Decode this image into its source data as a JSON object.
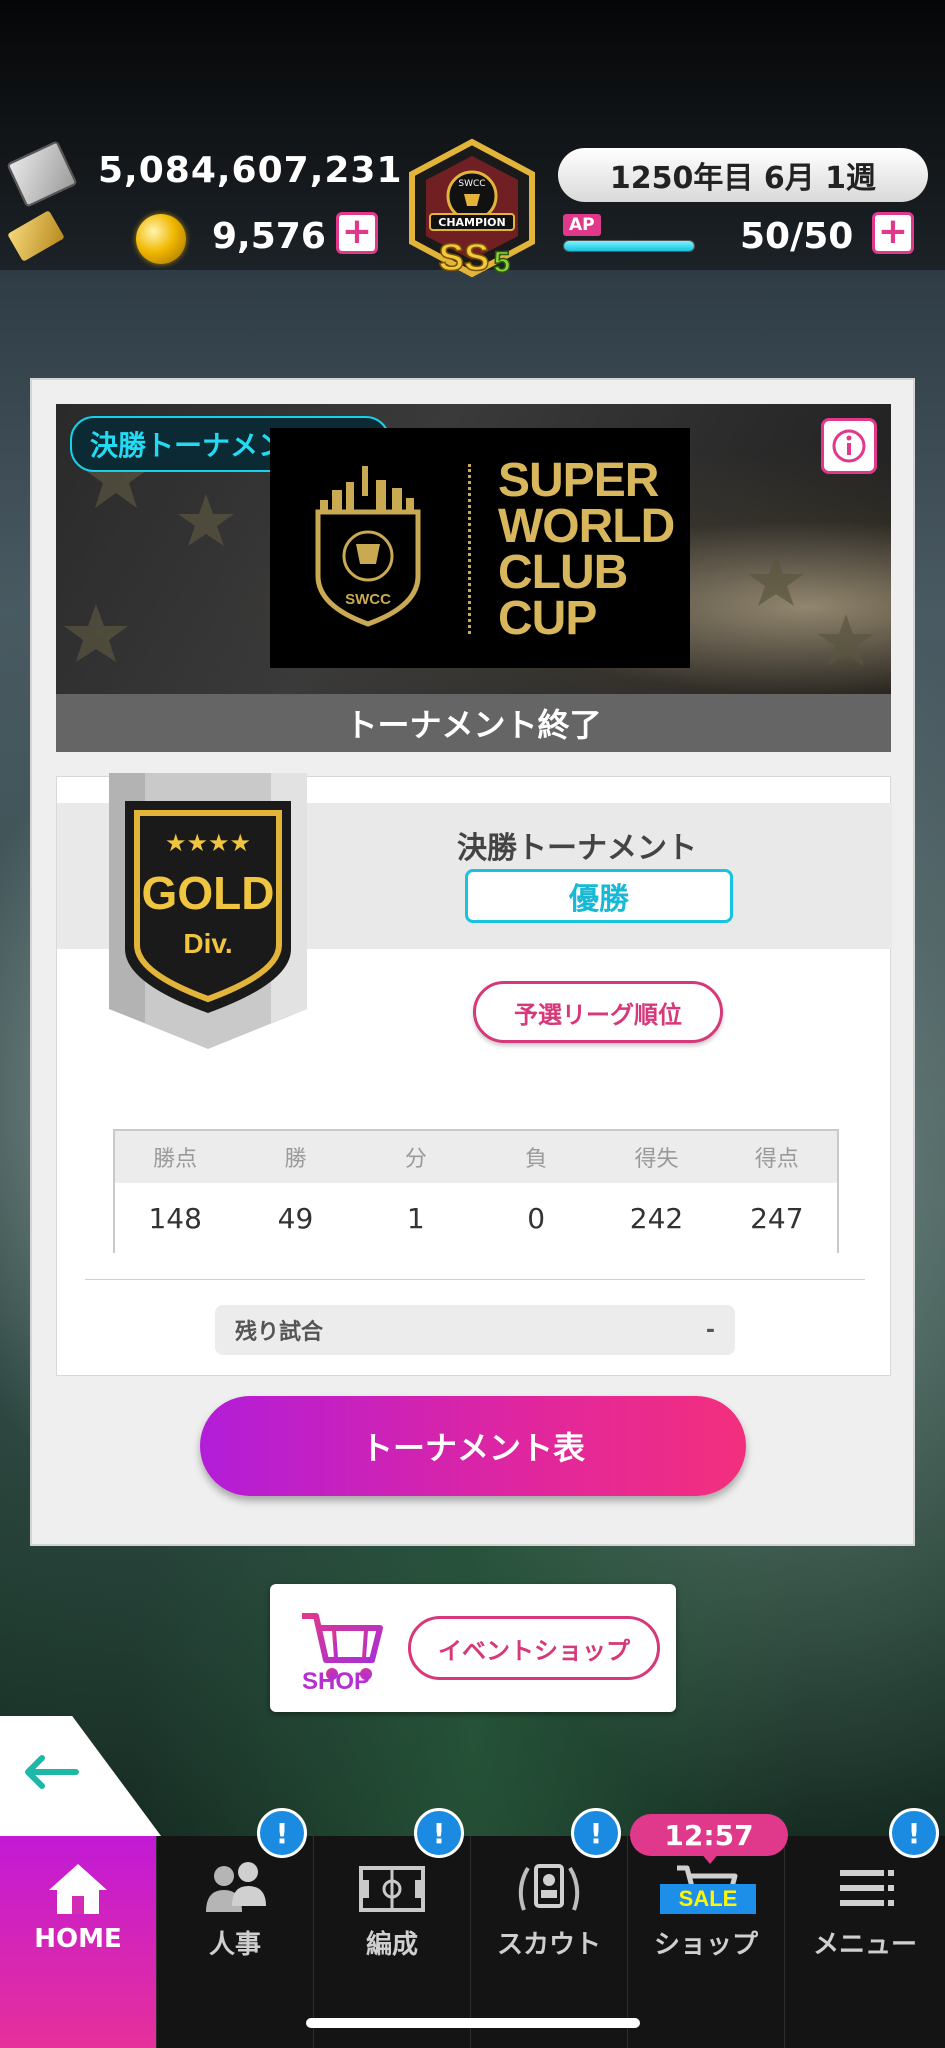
{
  "header": {
    "money": "5,084,607,231",
    "coins": "9,576",
    "date": "1250年目 6月 1週",
    "ap_label": "AP",
    "ap_value": "50/50",
    "ap_fraction": 1.0,
    "plus": "+",
    "emblem": {
      "top_text": "SWCC",
      "ribbon_text": "CHAMPION",
      "rank_text": "SS",
      "rank_number": "5"
    }
  },
  "banner": {
    "status_badge": "決勝トーナメント終了",
    "logo_crest_text": "SWCC",
    "logo_lines": [
      "SUPER",
      "WORLD",
      "CLUB",
      "CUP"
    ],
    "caption": "トーナメント終了"
  },
  "result": {
    "division": {
      "stars": "★★★★",
      "name": "GOLD",
      "sub": "Div."
    },
    "stage_title": "決勝トーナメント",
    "outcome": "優勝",
    "prelim_button": "予選リーグ順位",
    "stats_headers": [
      "勝点",
      "勝",
      "分",
      "負",
      "得失",
      "得点"
    ],
    "stats_values": [
      "148",
      "49",
      "1",
      "0",
      "242",
      "247"
    ],
    "remaining_label": "残り試合",
    "remaining_value": "-"
  },
  "bracket_button": "トーナメント表",
  "shop_banner": {
    "logo_word": "SHOP",
    "button": "イベントショップ"
  },
  "nav": {
    "items": [
      {
        "label": "HOME",
        "icon": "home-icon",
        "badge": ""
      },
      {
        "label": "人事",
        "icon": "people-icon",
        "badge": "!"
      },
      {
        "label": "編成",
        "icon": "pitch-icon",
        "badge": "!"
      },
      {
        "label": "スカウト",
        "icon": "scout-icon",
        "badge": "!"
      },
      {
        "label": "ショップ",
        "icon": "cart-icon",
        "badge": ""
      },
      {
        "label": "メニュー",
        "icon": "menu-icon",
        "badge": "!"
      }
    ],
    "shop_timer": "12:57",
    "sale_tag": "SALE"
  },
  "colors": {
    "accent_pink": "#e0388a",
    "accent_cyan": "#17c3de",
    "gold": "#d8b65c",
    "badge_blue": "#1a8be0"
  }
}
